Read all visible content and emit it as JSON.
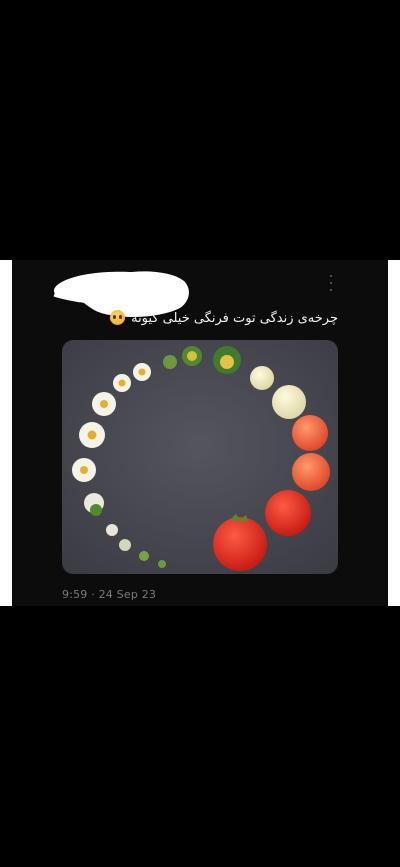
{
  "tweet": {
    "text": "چرخه‌ی زندگی توت فرنگی خیلی کیوته",
    "emoji_icon": "pleading-face-emoji",
    "timestamp": "9:59 · 24 Sep 23"
  },
  "photo": {
    "subject": "strawberry-life-cycle-circle",
    "plate_color": "#4a4a52"
  }
}
